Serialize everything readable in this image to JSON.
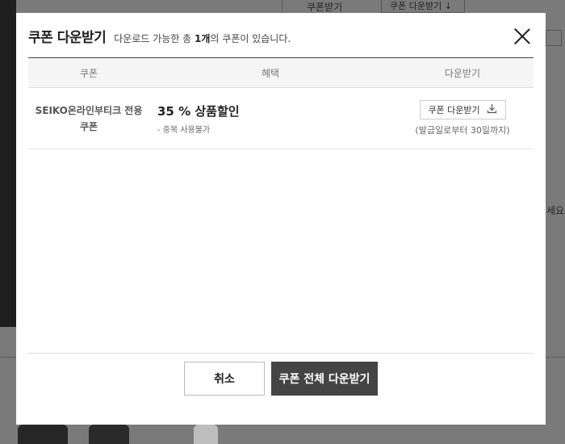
{
  "background": {
    "top_text": "쿠폰받기",
    "top_button": "쿠폰 다운받기 ↓",
    "right_text": "세요"
  },
  "modal": {
    "title": "쿠폰 다운받기",
    "subtitle_prefix": "다운로드 가능한 총 ",
    "subtitle_count": "1개",
    "subtitle_suffix": "의 쿠폰이 있습니다.",
    "close_icon": "close-icon"
  },
  "table": {
    "headers": {
      "coupon": "쿠폰",
      "benefit": "혜택",
      "download": "다운받기"
    },
    "rows": [
      {
        "coupon_name_line1": "SEIKO온라인부티크 전용",
        "coupon_name_line2": "쿠폰",
        "benefit_main": "35 % 상품할인",
        "benefit_sub": "- 중복 사용불가",
        "download_label": "쿠폰 다운받기",
        "download_icon": "download-icon",
        "download_note": "(발급일로부터 30일까지)"
      }
    ]
  },
  "footer": {
    "cancel_label": "취소",
    "download_all_label": "쿠폰 전체 다운받기"
  },
  "colors": {
    "primary_button": "#444444",
    "overlay": "#7a7a7a"
  }
}
